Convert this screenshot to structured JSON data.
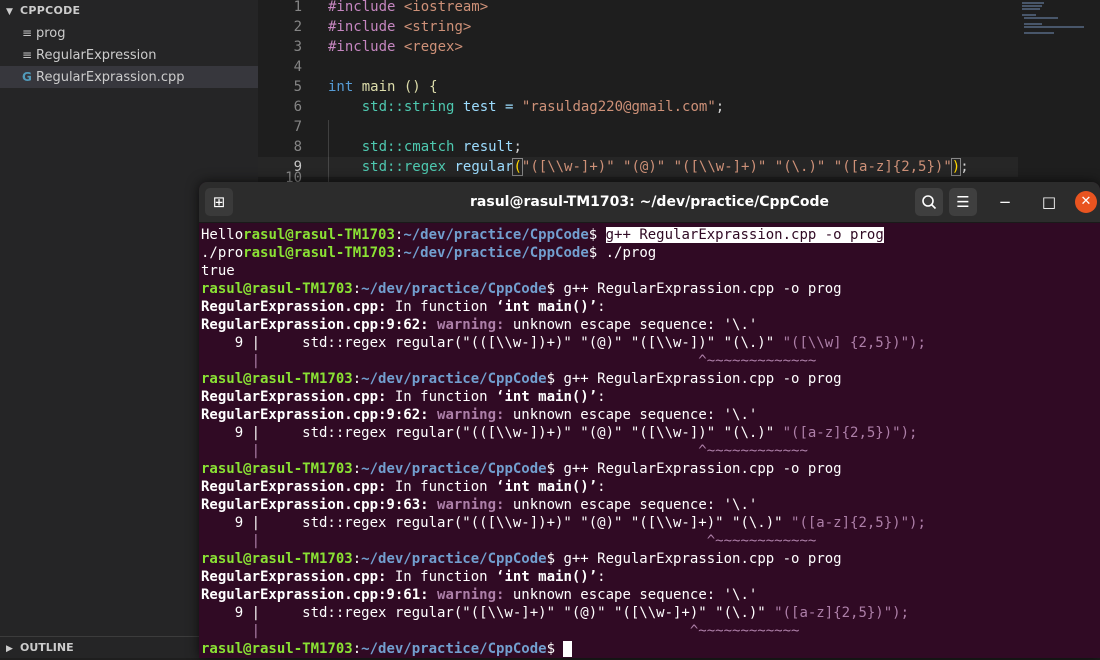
{
  "sidebar": {
    "header": "CPPCODE",
    "files": [
      {
        "name": "prog",
        "icon": "≡"
      },
      {
        "name": "RegularExpression",
        "icon": "≡"
      },
      {
        "name": "RegularExprassion.cpp",
        "icon": "G"
      }
    ],
    "outline_label": "OUTLINE"
  },
  "editor": {
    "lines": [
      {
        "n": "1",
        "a": "#include",
        "b": " <iostream>"
      },
      {
        "n": "2",
        "a": "#include",
        "b": " <string>"
      },
      {
        "n": "3",
        "a": "#include",
        "b": " <regex>"
      },
      {
        "n": "4"
      },
      {
        "n": "5",
        "a": "int",
        "b": " main () {"
      },
      {
        "n": "6",
        "a": "std::",
        "b": "string",
        "c": " test = ",
        "d": "\"rasuldag220@gmail.com\"",
        "e": ";"
      },
      {
        "n": "7"
      },
      {
        "n": "8",
        "a": "std::",
        "b": "cmatch",
        "c": " result",
        "d": ";"
      },
      {
        "n": "9",
        "a": "std::",
        "b": "regex",
        "c": " regular",
        "d": "(",
        "e": "\"([\\\\w-]+)\" \"(@)\" \"([\\\\w-]+)\" \"(\\.)\" \"([a-z]{2,5})\"",
        "f": ")",
        "g": ";"
      },
      {
        "n": "10"
      }
    ]
  },
  "terminal": {
    "title": "rasul@rasul-TM1703: ~/dev/practice/CppCode",
    "prompt_user": "rasul@rasul-TM1703",
    "prompt_path": "~/dev/practice/CppCode",
    "line1_prefix": "Hello",
    "line1_cmd": "g++ RegularExprassion.cpp -o prog",
    "line2_prefix": "./pro",
    "line2_cmd": "./prog",
    "line3": "true",
    "cmd": "g++ RegularExprassion.cpp -o prog",
    "in_function": "RegularExprassion.cpp:",
    "in_function_text": " In function ",
    "in_function_name": "‘int main()’",
    "in_function_end": ":",
    "warn_label": "warning:",
    "warn_text": " unknown escape sequence: '\\.'",
    "blocks": [
      {
        "loc": "RegularExprassion.cpp:9:62:",
        "code": "    9 |     std::regex regular(\"(([\\\\w-])+)\" \"(@)\" \"([\\\\w-])\" \"(\\.)\" ",
        "code_tail": "\"([\\\\w] {2,5})\");",
        "marker": "      |                                                    ^~~~~~~~~~~~~~"
      },
      {
        "loc": "RegularExprassion.cpp:9:62:",
        "code": "    9 |     std::regex regular(\"(([\\\\w-])+)\" \"(@)\" \"([\\\\w-])\" \"(\\.)\" ",
        "code_tail": "\"([a-z]{2,5})\");",
        "marker": "      |                                                    ^~~~~~~~~~~~~"
      },
      {
        "loc": "RegularExprassion.cpp:9:63:",
        "code": "    9 |     std::regex regular(\"(([\\\\w-])+)\" \"(@)\" \"([\\\\w-]+)\" \"(\\.)\" ",
        "code_tail": "\"([a-z]{2,5})\");",
        "marker": "      |                                                     ^~~~~~~~~~~~~"
      },
      {
        "loc": "RegularExprassion.cpp:9:61:",
        "code": "    9 |     std::regex regular(\"([\\\\w-]+)\" \"(@)\" \"([\\\\w-]+)\" \"(\\.)\" ",
        "code_tail": "\"([a-z]{2,5})\");",
        "marker": "      |                                                   ^~~~~~~~~~~~~"
      }
    ]
  }
}
